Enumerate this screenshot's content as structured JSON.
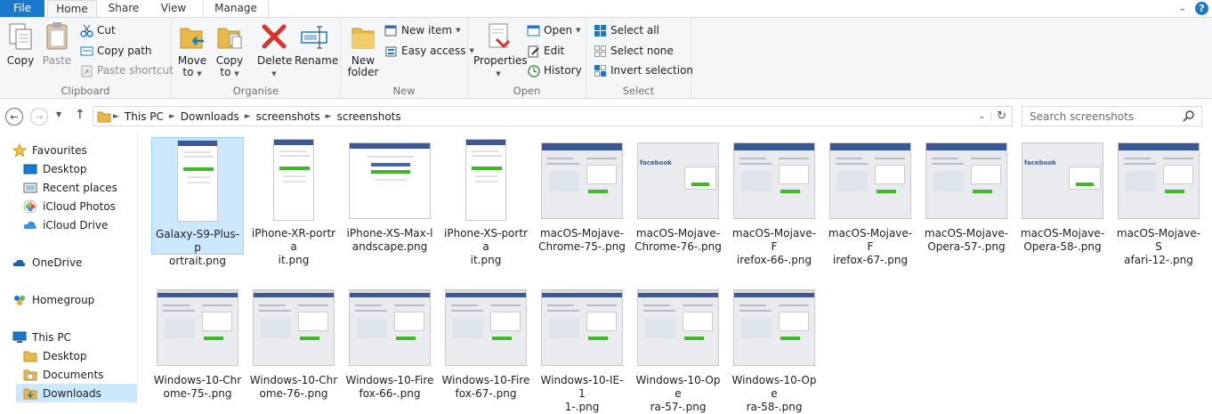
{
  "tabs": {
    "file": "File",
    "home": "Home",
    "share": "Share",
    "view": "View",
    "manage": "Manage"
  },
  "ribbon": {
    "clipboard": {
      "label": "Clipboard",
      "copy": "Copy",
      "paste": "Paste",
      "cut": "Cut",
      "copy_path": "Copy path",
      "paste_shortcut": "Paste shortcut"
    },
    "organise": {
      "label": "Organise",
      "move_to_1": "Move",
      "move_to_2": "to",
      "copy_to_1": "Copy",
      "copy_to_2": "to",
      "delete": "Delete",
      "rename": "Rename"
    },
    "new": {
      "label": "New",
      "new_folder_1": "New",
      "new_folder_2": "folder",
      "new_item": "New item",
      "easy_access": "Easy access"
    },
    "open": {
      "label": "Open",
      "properties": "Properties",
      "open": "Open",
      "edit": "Edit",
      "history": "History"
    },
    "select": {
      "label": "Select",
      "select_all": "Select all",
      "select_none": "Select none",
      "invert": "Invert selection"
    }
  },
  "address": {
    "crumbs": [
      "This PC",
      "Downloads",
      "screenshots",
      "screenshots"
    ],
    "search_placeholder": "Search screenshots"
  },
  "nav": {
    "favourites": "Favourites",
    "desktop": "Desktop",
    "recent": "Recent places",
    "icloud_photos": "iCloud Photos",
    "icloud_drive": "iCloud Drive",
    "onedrive": "OneDrive",
    "homegroup": "Homegroup",
    "this_pc": "This PC",
    "pc_desktop": "Desktop",
    "documents": "Documents",
    "downloads": "Downloads"
  },
  "files": [
    "Galaxy-S9-Plus-portrait.png",
    "iPhone-XR-portrait.png",
    "iPhone-XS-Max-landscape.png",
    "iPhone-XS-portrait.png",
    "macOS-Mojave-Chrome-75-.png",
    "macOS-Mojave-Chrome-76-.png",
    "macOS-Mojave-Firefox-66-.png",
    "macOS-Mojave-Firefox-67-.png",
    "macOS-Mojave-Opera-57-.png",
    "macOS-Mojave-Opera-58-.png",
    "macOS-Mojave-Safari-12-.png",
    "Windows-10-Chrome-75-.png",
    "Windows-10-Chrome-76-.png",
    "Windows-10-Firefox-66-.png",
    "Windows-10-Firefox-67-.png",
    "Windows-10-IE-11-.png",
    "Windows-10-Opera-57-.png",
    "Windows-10-Opera-58-.png"
  ],
  "file_lines": [
    [
      "Galaxy-S9-Plus-p",
      "ortrait.png"
    ],
    [
      "iPhone-XR-portra",
      "it.png"
    ],
    [
      "iPhone-XS-Max-l",
      "andscape.png"
    ],
    [
      "iPhone-XS-portra",
      "it.png"
    ],
    [
      "macOS-Mojave-",
      "Chrome-75-.png"
    ],
    [
      "macOS-Mojave-",
      "Chrome-76-.png"
    ],
    [
      "macOS-Mojave-F",
      "irefox-66-.png"
    ],
    [
      "macOS-Mojave-F",
      "irefox-67-.png"
    ],
    [
      "macOS-Mojave-",
      "Opera-57-.png"
    ],
    [
      "macOS-Mojave-",
      "Opera-58-.png"
    ],
    [
      "macOS-Mojave-S",
      "afari-12-.png"
    ],
    [
      "Windows-10-Chr",
      "ome-75-.png"
    ],
    [
      "Windows-10-Chr",
      "ome-76-.png"
    ],
    [
      "Windows-10-Fire",
      "fox-66-.png"
    ],
    [
      "Windows-10-Fire",
      "fox-67-.png"
    ],
    [
      "Windows-10-IE-1",
      "1-.png"
    ],
    [
      "Windows-10-Ope",
      "ra-57-.png"
    ],
    [
      "Windows-10-Ope",
      "ra-58-.png"
    ]
  ],
  "selected_file": "Galaxy-S9-Plus-portrait.png",
  "colors": {
    "accent": "#1979ca",
    "selection": "#cce8ff",
    "facebook": "#3b5998"
  }
}
